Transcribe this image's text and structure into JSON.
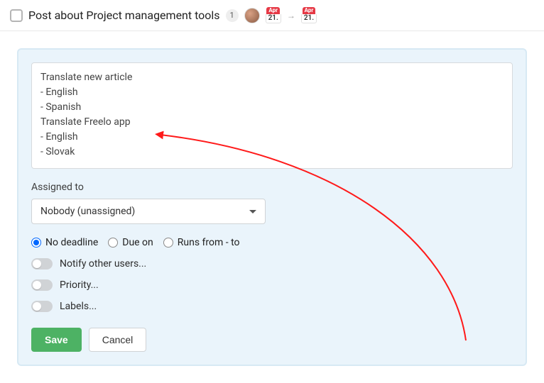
{
  "header": {
    "title": "Post about Project management tools",
    "comment_count": "1",
    "date_from": {
      "month": "Apr",
      "day": "21."
    },
    "date_to": {
      "month": "Apr",
      "day": "21."
    }
  },
  "form": {
    "body": "Translate new article\n- English\n- Spanish\nTranslate Freelo app\n- English\n- Slovak",
    "assigned_label": "Assigned to",
    "assigned_value": "Nobody (unassigned)",
    "deadline": {
      "none": "No deadline",
      "due": "Due on",
      "range": "Runs from - to"
    },
    "toggles": {
      "notify": "Notify other users...",
      "priority": "Priority...",
      "labels": "Labels..."
    },
    "buttons": {
      "save": "Save",
      "cancel": "Cancel"
    }
  }
}
